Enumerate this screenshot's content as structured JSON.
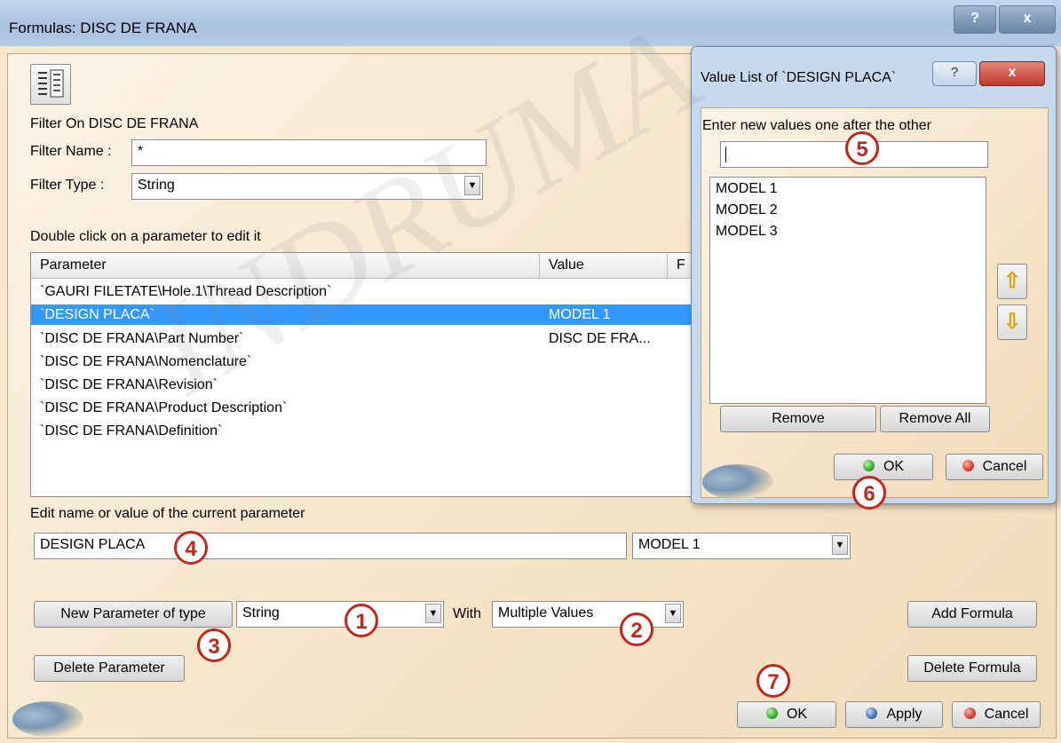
{
  "window": {
    "title": "Formulas: DISC DE FRANA",
    "help": "?",
    "close": "x"
  },
  "filter": {
    "heading": "Filter On DISC DE FRANA",
    "name_label": "Filter Name :",
    "name_value": "*",
    "type_label": "Filter Type :",
    "type_value": "String"
  },
  "list_hint": "Double click on a parameter to edit it",
  "table": {
    "columns": [
      "Parameter",
      "Value",
      "F"
    ],
    "rows": [
      {
        "param": "`GAURI FILETATE\\Hole.1\\Thread Description`",
        "value": ""
      },
      {
        "param": "`DESIGN PLACA`",
        "value": "MODEL 1",
        "selected": true
      },
      {
        "param": "`DISC DE FRANA\\Part Number`",
        "value": "DISC DE FRA..."
      },
      {
        "param": "`DISC DE FRANA\\Nomenclature`",
        "value": ""
      },
      {
        "param": "`DISC DE FRANA\\Revision`",
        "value": ""
      },
      {
        "param": "`DISC DE FRANA\\Product Description`",
        "value": ""
      },
      {
        "param": "`DISC DE FRANA\\Definition`",
        "value": ""
      }
    ]
  },
  "edit": {
    "label": "Edit name or value of the current parameter",
    "name_value": "DESIGN PLACA",
    "value_value": "MODEL 1"
  },
  "new_param": {
    "button": "New Parameter of type",
    "type_value": "String",
    "with_label": "With",
    "with_value": "Multiple Values"
  },
  "buttons": {
    "add_formula": "Add Formula",
    "delete_parameter": "Delete Parameter",
    "delete_formula": "Delete Formula",
    "ok": "OK",
    "apply": "Apply",
    "cancel": "Cancel"
  },
  "value_list": {
    "title": "Value List of `DESIGN PLACA`",
    "help": "?",
    "close": "x",
    "prompt": "Enter new values one after the other",
    "input_value": "",
    "items": [
      "MODEL 1",
      "MODEL 2",
      "MODEL 3"
    ],
    "remove": "Remove",
    "remove_all": "Remove All",
    "ok": "OK",
    "cancel": "Cancel"
  },
  "callouts": [
    "1",
    "2",
    "3",
    "4",
    "5",
    "6",
    "7"
  ],
  "watermark": "INDRUMA",
  "colors": {
    "selection": "#3399ff",
    "callout": "#c0271f"
  }
}
